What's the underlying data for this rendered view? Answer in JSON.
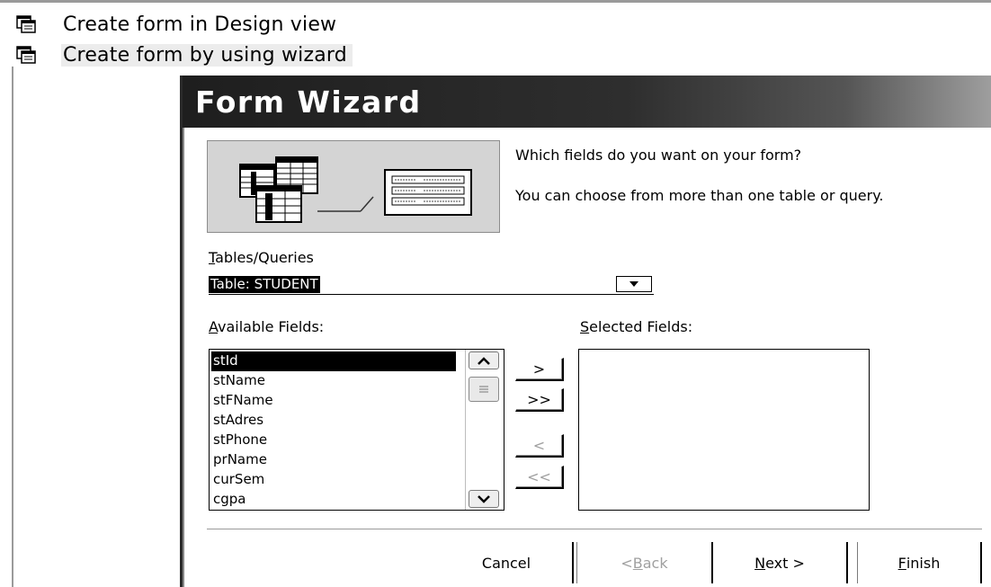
{
  "objects_panel": {
    "items": [
      {
        "label": "Create form in Design view",
        "icon": "form-icon"
      },
      {
        "label": "Create form by using wizard",
        "icon": "form-icon"
      }
    ]
  },
  "dialog": {
    "title": "Form Wizard",
    "illustration": "tables-to-form-illustration",
    "prompt_line1": "Which fields do you want on your form?",
    "prompt_line2": "You can choose from more than one table or query.",
    "tables_queries": {
      "label_access_key": "T",
      "label_rest": "ables/Queries",
      "selected_value": "Table: STUDENT"
    },
    "available_fields": {
      "label_access_key": "A",
      "label_rest": "vailable Fields:",
      "items": [
        "stId",
        "stName",
        "stFName",
        "stAdres",
        "stPhone",
        "prName",
        "curSem",
        "cgpa"
      ],
      "selected_item": "stId"
    },
    "selected_fields": {
      "label_access_key": "S",
      "label_rest": "elected Fields:",
      "items": []
    },
    "move_buttons": {
      "add": ">",
      "add_all": ">>",
      "remove": "<",
      "remove_all": "<<"
    },
    "footer": {
      "cancel": "Cancel",
      "back_prefix": "< ",
      "back_key": "B",
      "back_rest": "ack",
      "next_key": "N",
      "next_rest": "ext >",
      "finish_key": "F",
      "finish_rest": "inish"
    }
  }
}
